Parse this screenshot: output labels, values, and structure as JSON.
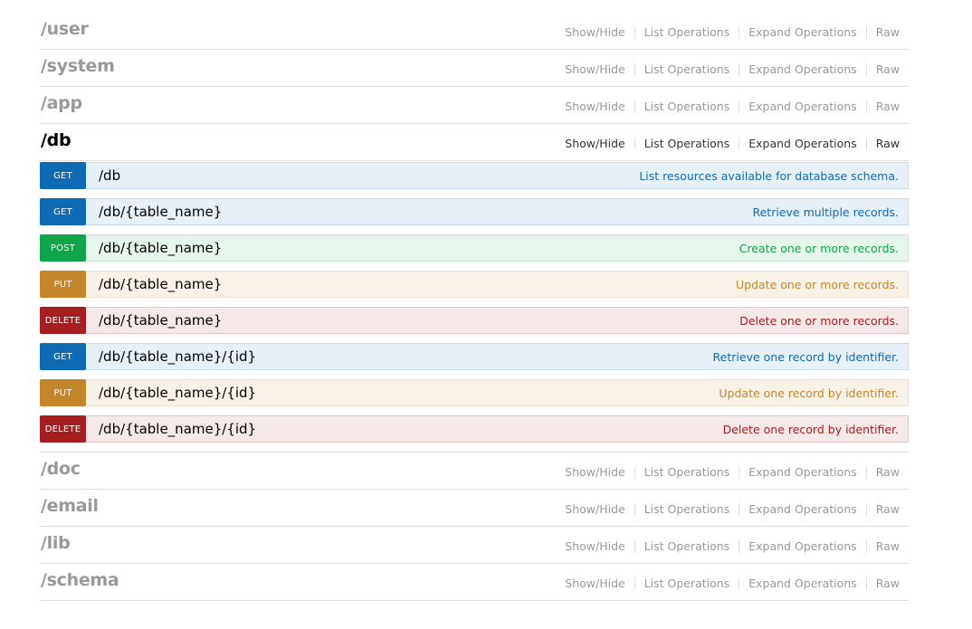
{
  "link_labels": {
    "show_hide": "Show/Hide",
    "list_operations": "List Operations",
    "expand_operations": "Expand Operations",
    "raw": "Raw"
  },
  "resources": [
    {
      "name": "/user",
      "active": false,
      "operations": []
    },
    {
      "name": "/system",
      "active": false,
      "operations": []
    },
    {
      "name": "/app",
      "active": false,
      "operations": []
    },
    {
      "name": "/db",
      "active": true,
      "operations": [
        {
          "method": "GET",
          "path": "/db",
          "summary": "List resources available for database schema."
        },
        {
          "method": "GET",
          "path": "/db/{table_name}",
          "summary": "Retrieve multiple records."
        },
        {
          "method": "POST",
          "path": "/db/{table_name}",
          "summary": "Create one or more records."
        },
        {
          "method": "PUT",
          "path": "/db/{table_name}",
          "summary": "Update one or more records."
        },
        {
          "method": "DELETE",
          "path": "/db/{table_name}",
          "summary": "Delete one or more records."
        },
        {
          "method": "GET",
          "path": "/db/{table_name}/{id}",
          "summary": "Retrieve one record by identifier."
        },
        {
          "method": "PUT",
          "path": "/db/{table_name}/{id}",
          "summary": "Update one record by identifier."
        },
        {
          "method": "DELETE",
          "path": "/db/{table_name}/{id}",
          "summary": "Delete one record by identifier."
        }
      ]
    },
    {
      "name": "/doc",
      "active": false,
      "operations": []
    },
    {
      "name": "/email",
      "active": false,
      "operations": []
    },
    {
      "name": "/lib",
      "active": false,
      "operations": []
    },
    {
      "name": "/schema",
      "active": false,
      "operations": []
    }
  ],
  "colors": {
    "get": "#0f6ab4",
    "post": "#10a54a",
    "put": "#c5862b",
    "delete": "#a41e22",
    "inactive_text": "#999999",
    "divider": "#dddddd"
  }
}
